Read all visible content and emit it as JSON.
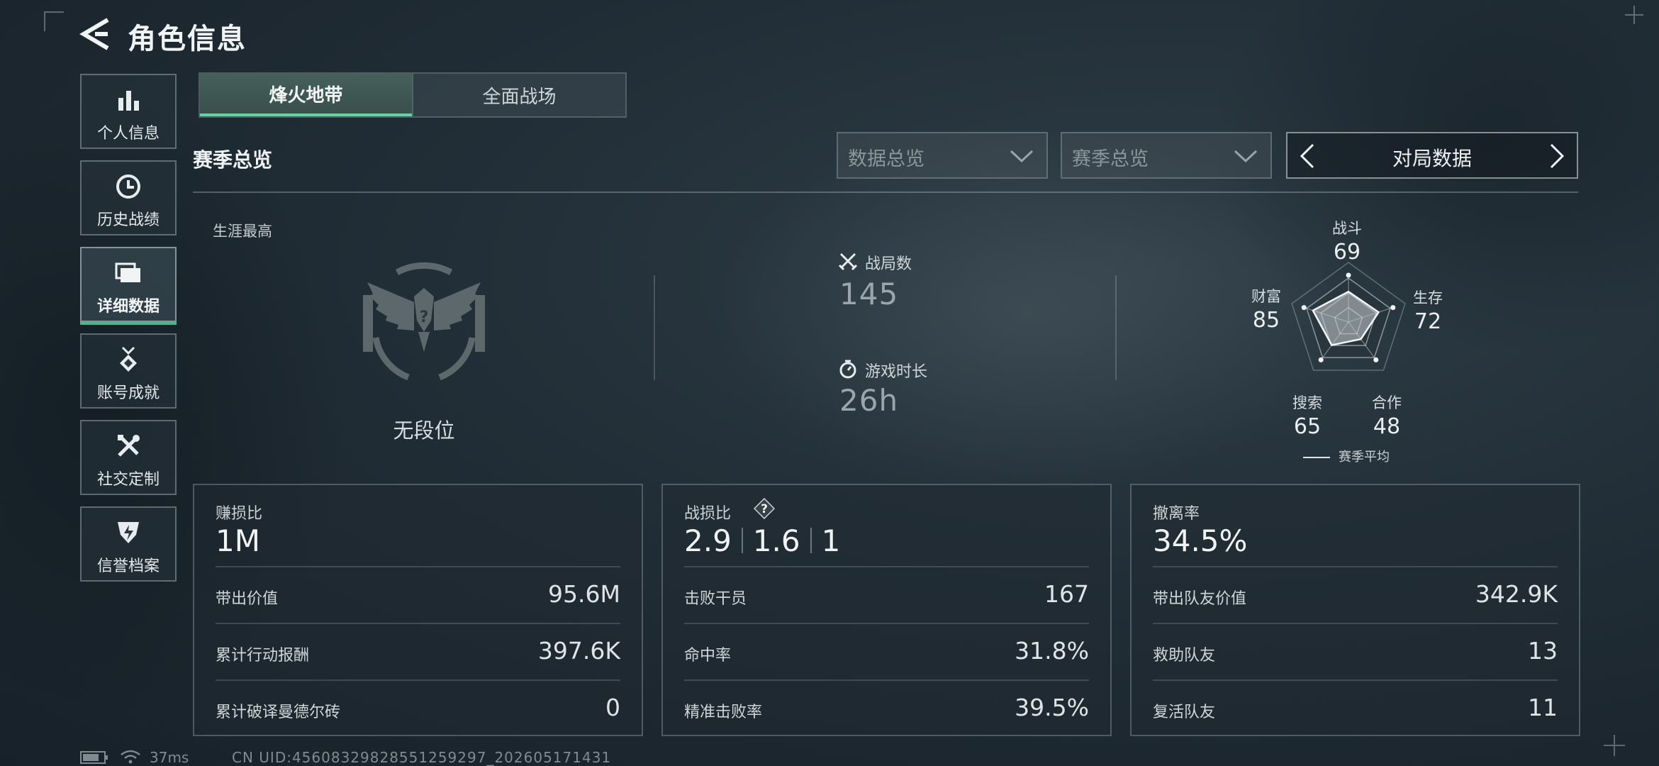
{
  "header": {
    "title": "角色信息"
  },
  "sidebar": {
    "items": [
      {
        "label": "个人信息",
        "icon": "bar-chart-icon"
      },
      {
        "label": "历史战绩",
        "icon": "clock-icon"
      },
      {
        "label": "详细数据",
        "icon": "folder-icon",
        "active": true
      },
      {
        "label": "账号成就",
        "icon": "medal-icon"
      },
      {
        "label": "社交定制",
        "icon": "tools-icon"
      },
      {
        "label": "信誉档案",
        "icon": "shield-bolt-icon"
      }
    ]
  },
  "tabs": [
    {
      "label": "烽火地带",
      "active": true
    },
    {
      "label": "全面战场",
      "active": false
    }
  ],
  "section": {
    "title": "赛季总览"
  },
  "filters": {
    "data_select": "数据总览",
    "season_select": "赛季总览",
    "pager_label": "对局数据"
  },
  "overview": {
    "career_label": "生涯最高",
    "rank_label": "无段位",
    "matches_label": "战局数",
    "matches_value": "145",
    "playtime_label": "游戏时长",
    "playtime_value": "26h"
  },
  "radar": {
    "axes": [
      {
        "label": "战斗",
        "value": "69"
      },
      {
        "label": "生存",
        "value": "72"
      },
      {
        "label": "合作",
        "value": "48"
      },
      {
        "label": "搜索",
        "value": "65"
      },
      {
        "label": "财富",
        "value": "85"
      }
    ],
    "legend": "赛季平均"
  },
  "cards": [
    {
      "label": "赚损比",
      "big": "1M",
      "rows": [
        {
          "k": "带出价值",
          "v": "95.6M"
        },
        {
          "k": "累计行动报酬",
          "v": "397.6K"
        },
        {
          "k": "累计破译曼德尔砖",
          "v": "0"
        }
      ]
    },
    {
      "label": "战损比",
      "ratios": [
        "2.9",
        "1.6",
        "1"
      ],
      "rows": [
        {
          "k": "击败干员",
          "v": "167"
        },
        {
          "k": "命中率",
          "v": "31.8%"
        },
        {
          "k": "精准击败率",
          "v": "39.5%"
        }
      ]
    },
    {
      "label": "撤离率",
      "big": "34.5%",
      "rows": [
        {
          "k": "带出队友价值",
          "v": "342.9K"
        },
        {
          "k": "救助队友",
          "v": "13"
        },
        {
          "k": "复活队友",
          "v": "11"
        }
      ]
    }
  ],
  "footer": {
    "ping": "37ms",
    "uid": "CN UID:4560832982855125929​7_202605171431"
  },
  "colors": {
    "accent": "#5fd3a0",
    "active_underline": "#46b98a"
  }
}
